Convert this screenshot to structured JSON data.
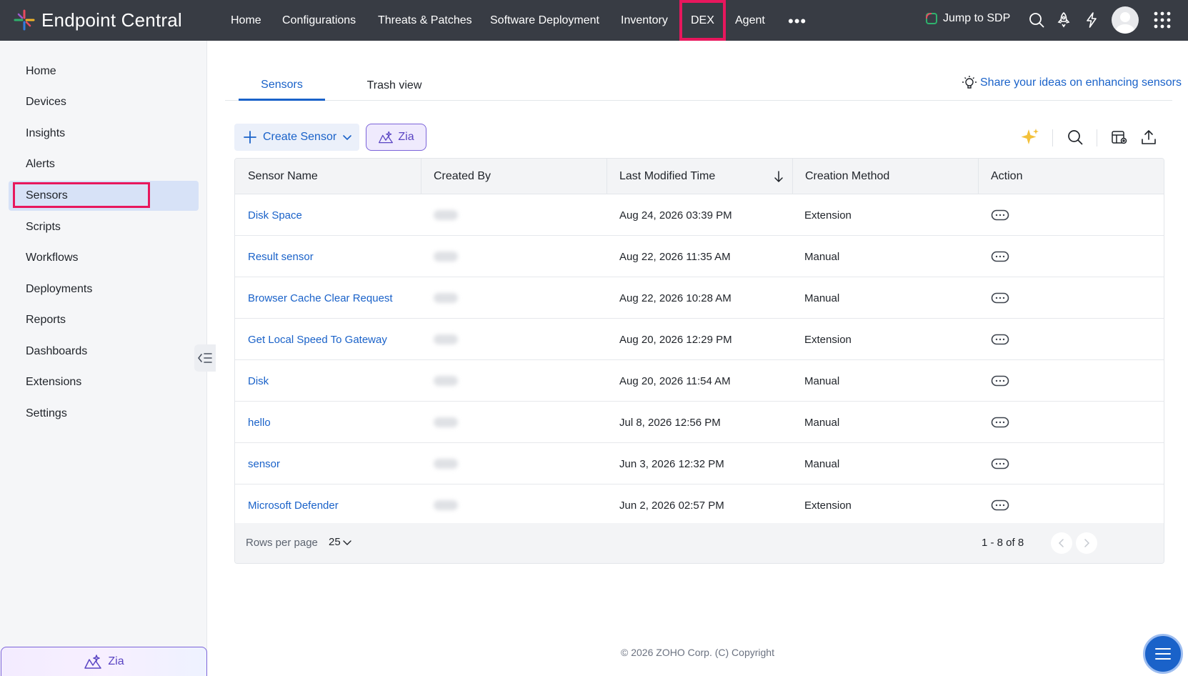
{
  "brand": {
    "name": "Endpoint Central",
    "logo": "endpoint-central-logo"
  },
  "topnav": {
    "items": [
      {
        "label": "Home"
      },
      {
        "label": "Configurations"
      },
      {
        "label": "Threats & Patches"
      },
      {
        "label": "Software Deployment"
      },
      {
        "label": "Inventory"
      },
      {
        "label": "DEX",
        "active": true
      },
      {
        "label": "Agent"
      }
    ],
    "more": "•••",
    "jump_label": "Jump to SDP",
    "icons": [
      "search-icon",
      "rocket-icon",
      "bolt-icon",
      "avatar",
      "apps-grid-icon"
    ]
  },
  "sidebar": {
    "items": [
      {
        "label": "Home"
      },
      {
        "label": "Devices"
      },
      {
        "label": "Insights"
      },
      {
        "label": "Alerts"
      },
      {
        "label": "Sensors",
        "active": true
      },
      {
        "label": "Scripts"
      },
      {
        "label": "Workflows"
      },
      {
        "label": "Deployments"
      },
      {
        "label": "Reports"
      },
      {
        "label": "Dashboards"
      },
      {
        "label": "Extensions"
      },
      {
        "label": "Settings"
      }
    ],
    "zia_label": "Zia"
  },
  "tabs": [
    {
      "label": "Sensors",
      "active": true
    },
    {
      "label": "Trash view"
    }
  ],
  "share_link": "Share your ideas on enhancing sensors",
  "toolbar": {
    "create_label": "Create Sensor",
    "zia_label": "Zia",
    "icons": [
      "sparkle-icon",
      "search-icon",
      "column-settings-icon",
      "export-icon"
    ]
  },
  "table": {
    "headers": [
      "Sensor Name",
      "Created By",
      "Last Modified Time",
      "Creation Method",
      "Action"
    ],
    "sort": {
      "column": "Last Modified Time",
      "direction": "descending"
    },
    "rows": [
      {
        "name": "Disk Space",
        "modified": "Aug 24, 2026 03:39 PM",
        "method": "Extension"
      },
      {
        "name": "Result sensor",
        "modified": "Aug 22, 2026 11:35 AM",
        "method": "Manual"
      },
      {
        "name": "Browser Cache Clear Request",
        "modified": "Aug 22, 2026 10:28 AM",
        "method": "Manual"
      },
      {
        "name": "Get Local Speed To Gateway",
        "modified": "Aug 20, 2026 12:29 PM",
        "method": "Extension"
      },
      {
        "name": "Disk",
        "modified": "Aug 20, 2026 11:54 AM",
        "method": "Manual"
      },
      {
        "name": "hello",
        "modified": "Jul 8, 2026 12:56 PM",
        "method": "Manual"
      },
      {
        "name": "sensor",
        "modified": "Jun 3, 2026 12:32 PM",
        "method": "Manual"
      },
      {
        "name": "Microsoft Defender",
        "modified": "Jun 2, 2026 02:57 PM",
        "method": "Extension"
      }
    ]
  },
  "pagination": {
    "rows_per_page_label": "Rows per page",
    "rows_per_page_value": "25",
    "range": "1 - 8 of 8"
  },
  "footer": {
    "copyright": "© 2026 ZOHO Corp. (C) Copyright"
  },
  "colors": {
    "topbar": "#383c44",
    "accent": "#1a62c9",
    "highlight": "#e8175d",
    "zia": "#7b63d9"
  }
}
